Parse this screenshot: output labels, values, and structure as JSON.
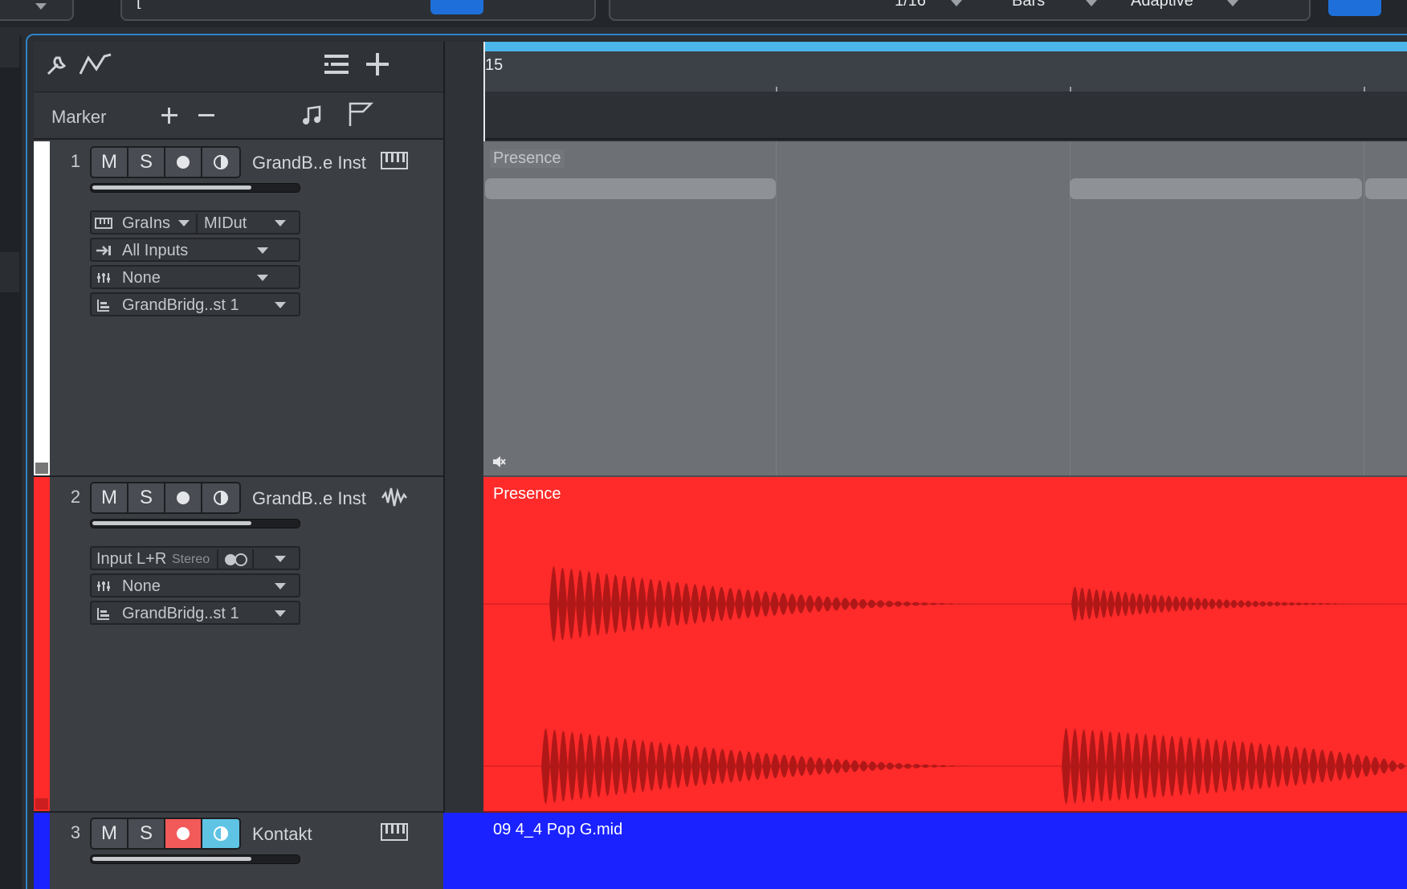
{
  "toolbar": {
    "quantize": "1/16",
    "timebase": "Bars",
    "snap": "Adaptive"
  },
  "header": {
    "marker_label": "Marker"
  },
  "ruler": {
    "bar_number": "15"
  },
  "tracks": [
    {
      "number": "1",
      "name": "GrandB..e Inst",
      "color": "#ffffff",
      "type_icon": "piano-keys-icon",
      "buttons": {
        "mute": "M",
        "solo": "S"
      },
      "fader_level": 0.77,
      "input_instrument": "GraIns",
      "midi_out": "MIDut",
      "input": "All Inputs",
      "send": "None",
      "output": "GrandBridg..st 1",
      "event": {
        "label": "Presence",
        "color": "#6d7075",
        "muted": true
      }
    },
    {
      "number": "2",
      "name": "GrandB..e Inst",
      "color": "#ff2a2a",
      "type_icon": "waveform-icon",
      "buttons": {
        "mute": "M",
        "solo": "S"
      },
      "fader_level": 0.77,
      "input": "Input L+R",
      "input_mode": "Stereo",
      "send": "None",
      "output": "GrandBridg..st 1",
      "event": {
        "label": "Presence",
        "color": "#ff2a2a"
      }
    },
    {
      "number": "3",
      "name": "Kontakt",
      "color": "#1a22ff",
      "type_icon": "piano-keys-icon",
      "buttons": {
        "mute": "M",
        "solo": "S"
      },
      "record_armed": true,
      "monitor_on": true,
      "fader_level": 0.77,
      "event": {
        "label": "09 4_4 Pop G.mid",
        "color": "#1a22ff"
      }
    }
  ]
}
